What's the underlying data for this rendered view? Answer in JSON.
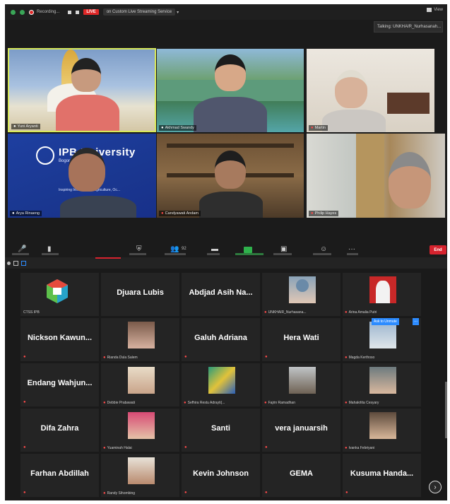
{
  "window": {
    "recording_label": "Recording...",
    "live_label": "LIVE",
    "stream_label": "on Custom Live Streaming Service",
    "view_label": "View",
    "talking_label": "Talking: UNKHAIR_Nurhasanah..."
  },
  "speakers": [
    {
      "name": "Yuni Aryanti"
    },
    {
      "name": "Akhmad Swandy"
    },
    {
      "name": "Martin"
    },
    {
      "name": "Arya Rinaeng",
      "bg_title": "IPB University",
      "bg_sub": "Bogor Indonesia",
      "bg_tag": "Inspiring Innovation in Agriculture, Oc..."
    },
    {
      "name": "Candyawati Andam"
    },
    {
      "name": "Philip Hayes"
    }
  ],
  "toolbar": {
    "end_label": "End",
    "participants_count": "92"
  },
  "participants": [
    {
      "name": "CTSS IPB",
      "kind": "logo"
    },
    {
      "name": "Djuara Lubis",
      "kind": "text"
    },
    {
      "name": "Abdjad Asih Na...",
      "kind": "text"
    },
    {
      "name": "UNKHAIR_Nurhasana...",
      "kind": "photo"
    },
    {
      "name": "Arina Amalia Putri",
      "kind": "photo"
    },
    {
      "name": "Nickson Kawun...",
      "kind": "text"
    },
    {
      "name": "Rianda Dula Salem",
      "kind": "photo"
    },
    {
      "name": "Galuh Adriana",
      "kind": "text"
    },
    {
      "name": "Hera Wati",
      "kind": "text"
    },
    {
      "name": "Magda Kerthoso",
      "kind": "photo"
    },
    {
      "name": "Endang Wahjun...",
      "kind": "text"
    },
    {
      "name": "Debbie Prabawati",
      "kind": "photo"
    },
    {
      "name": "Sefhira Restu Adrayti(...",
      "kind": "photo"
    },
    {
      "name": "Fajrin Ramadhan",
      "kind": "photo"
    },
    {
      "name": "Mahakrlita Cesyary",
      "kind": "photo"
    },
    {
      "name": "Difa Zahra",
      "kind": "text"
    },
    {
      "name": "Yuaminah Halai",
      "kind": "photo"
    },
    {
      "name": "Santi",
      "kind": "text"
    },
    {
      "name": "vera januarsih",
      "kind": "text"
    },
    {
      "name": "Ivanka Febriyani",
      "kind": "photo"
    },
    {
      "name": "Farhan Abdillah",
      "kind": "text"
    },
    {
      "name": "Randy Sihombing",
      "kind": "photo"
    },
    {
      "name": "Kevin Johnson",
      "kind": "text"
    },
    {
      "name": "GEMA",
      "kind": "text"
    },
    {
      "name": "Kusuma Handa...",
      "kind": "text"
    }
  ],
  "ask_to_unmute_label": "Ask to Unmute",
  "ask_more_label": "...",
  "scroll_next_label": "›"
}
